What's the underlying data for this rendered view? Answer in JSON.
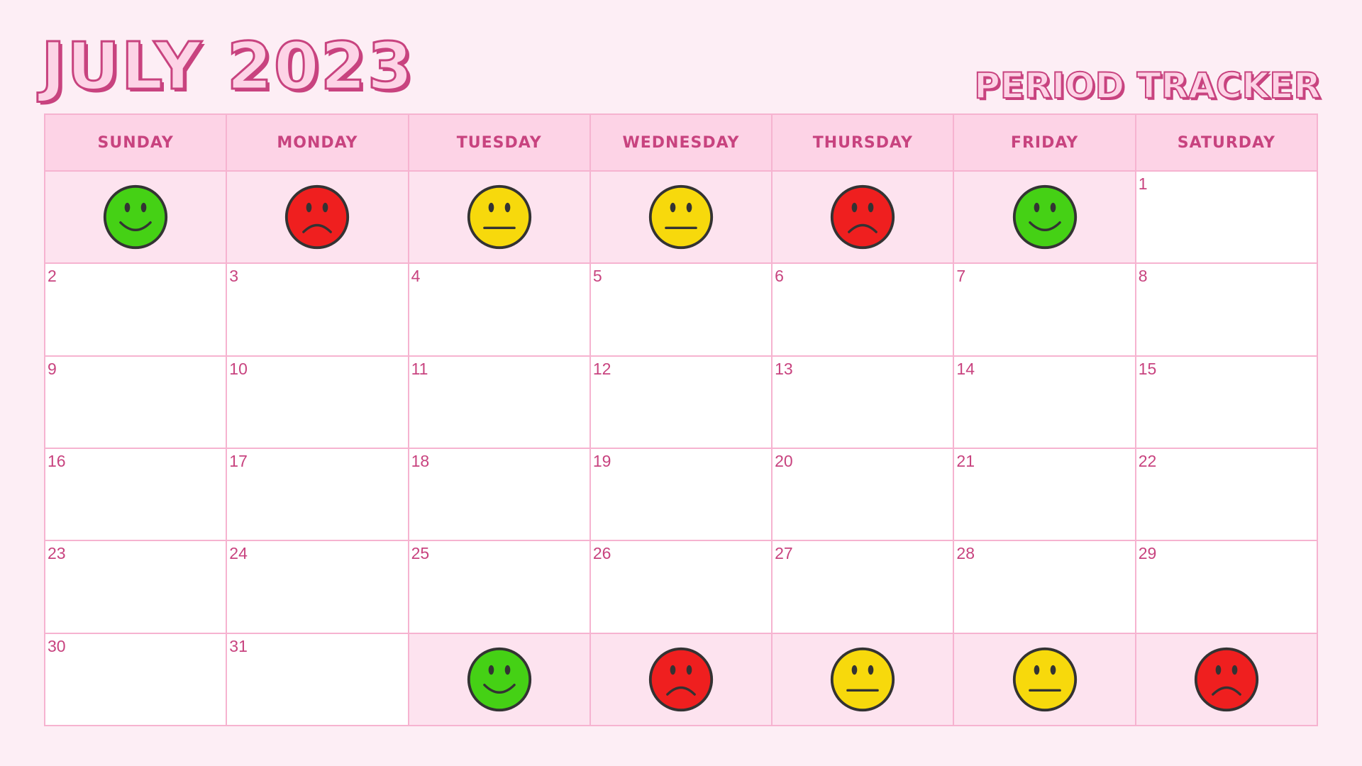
{
  "title": "JULY 2023",
  "subtitle": "PERIOD TRACKER",
  "weekdays": [
    "SUNDAY",
    "MONDAY",
    "TUESDAY",
    "WEDNESDAY",
    "THURSDAY",
    "FRIDAY",
    "SATURDAY"
  ],
  "colors": {
    "happy": "#45d115",
    "neutral": "#f7d90c",
    "sad": "#ef1f1f",
    "accent": "#c8437f",
    "grid": "#f6b3d0",
    "header_bg": "#fdd3e6",
    "filler_bg": "#fde3ef"
  },
  "cells": [
    {
      "mood": "happy"
    },
    {
      "mood": "sad"
    },
    {
      "mood": "neutral"
    },
    {
      "mood": "neutral"
    },
    {
      "mood": "sad"
    },
    {
      "mood": "happy"
    },
    {
      "day": "1"
    },
    {
      "day": "2"
    },
    {
      "day": "3"
    },
    {
      "day": "4"
    },
    {
      "day": "5"
    },
    {
      "day": "6"
    },
    {
      "day": "7"
    },
    {
      "day": "8"
    },
    {
      "day": "9"
    },
    {
      "day": "10"
    },
    {
      "day": "11"
    },
    {
      "day": "12"
    },
    {
      "day": "13"
    },
    {
      "day": "14"
    },
    {
      "day": "15"
    },
    {
      "day": "16"
    },
    {
      "day": "17"
    },
    {
      "day": "18"
    },
    {
      "day": "19"
    },
    {
      "day": "20"
    },
    {
      "day": "21"
    },
    {
      "day": "22"
    },
    {
      "day": "23"
    },
    {
      "day": "24"
    },
    {
      "day": "25"
    },
    {
      "day": "26"
    },
    {
      "day": "27"
    },
    {
      "day": "28"
    },
    {
      "day": "29"
    },
    {
      "day": "30"
    },
    {
      "day": "31"
    },
    {
      "mood": "happy"
    },
    {
      "mood": "sad"
    },
    {
      "mood": "neutral"
    },
    {
      "mood": "neutral"
    },
    {
      "mood": "sad"
    }
  ]
}
